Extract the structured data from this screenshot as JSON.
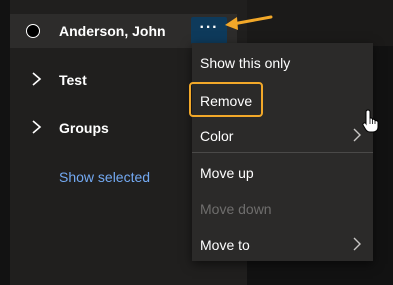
{
  "person": {
    "name": "Anderson, John",
    "more_button_label": "···"
  },
  "groups": [
    {
      "label": "Test"
    },
    {
      "label": "Groups"
    }
  ],
  "show_selected_link": "Show selected",
  "context_menu": {
    "items": [
      {
        "label": "Show this only",
        "has_submenu": false,
        "disabled": false
      },
      {
        "label": "Remove",
        "has_submenu": false,
        "disabled": false,
        "highlighted": true
      },
      {
        "label": "Color",
        "has_submenu": true,
        "disabled": false
      },
      {
        "label": "Move up",
        "has_submenu": false,
        "disabled": false
      },
      {
        "label": "Move down",
        "has_submenu": false,
        "disabled": true
      },
      {
        "label": "Move to",
        "has_submenu": true,
        "disabled": false
      }
    ]
  },
  "icons": {
    "radio": "radio-unchecked-icon",
    "more": "more-horizontal-icon",
    "chevron_right": "chevron-right-icon",
    "arrow": "annotation-arrow-icon",
    "cursor": "hand-pointer-icon"
  },
  "colors": {
    "background": "#1b1a19",
    "left_pane": "#201f1e",
    "selected_row": "#2d2c2b",
    "more_button": "#0e3a5b",
    "menu_background": "#2b2a29",
    "link": "#73a9f2",
    "annotation": "#f2a829",
    "disabled_text": "#6f6e6d"
  }
}
